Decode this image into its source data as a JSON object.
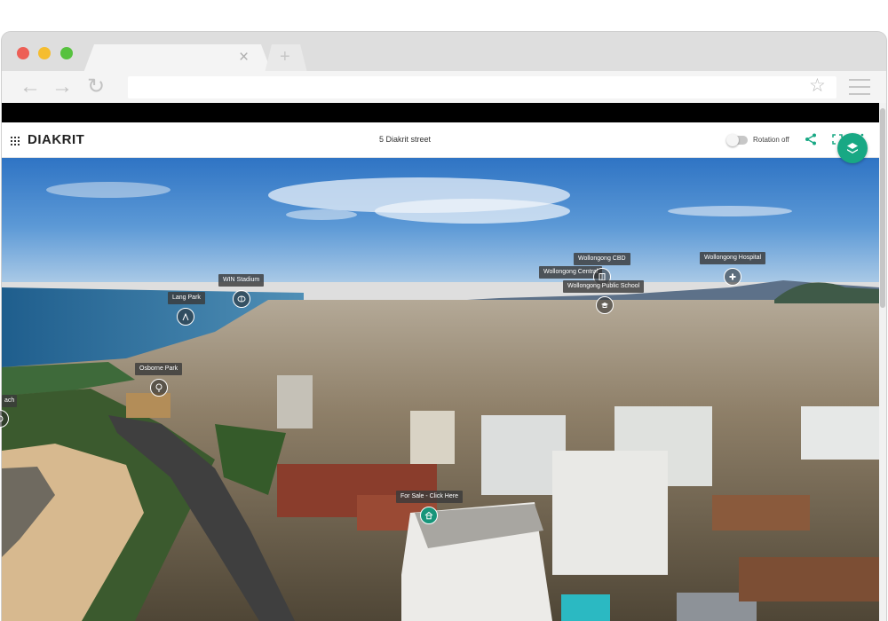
{
  "app": {
    "brand": "DIAKRIT",
    "address": "5 Diakrit street",
    "rotation_label": "Rotation off",
    "rotation_on": false
  },
  "browser": {
    "tab_close_glyph": "×",
    "new_tab_glyph": "+",
    "back_glyph": "←",
    "forward_glyph": "→",
    "reload_glyph": "↻",
    "star_glyph": "☆",
    "url": ""
  },
  "icons": {
    "apps": "grid-icon",
    "share": "share-icon",
    "fullscreen": "fullscreen-icon",
    "more": "more-vertical-icon",
    "layers": "layers-icon"
  },
  "colors": {
    "accent": "#18a884",
    "sale_pin": "#17957a",
    "label_bg": "#3a3a3a"
  },
  "pois": [
    {
      "id": "win-stadium",
      "label": "WIN Stadium",
      "icon": "stadium-icon"
    },
    {
      "id": "lang-park",
      "label": "Lang Park",
      "icon": "park-icon"
    },
    {
      "id": "osborne-park",
      "label": "Osborne Park",
      "icon": "tree-icon"
    },
    {
      "id": "wollongong-cbd",
      "label": "Wollongong CBD",
      "icon": "building-icon"
    },
    {
      "id": "wollongong-central",
      "label": "Wollongong Central",
      "icon": "shop-icon"
    },
    {
      "id": "wollongong-public-school",
      "label": "Wollongong Public School",
      "icon": "school-icon"
    },
    {
      "id": "wollongong-hospital",
      "label": "Wollongong Hospital",
      "icon": "hospital-icon"
    },
    {
      "id": "for-sale",
      "label": "For Sale - Click Here",
      "icon": "home-icon"
    },
    {
      "id": "edge-beach",
      "label": "ach",
      "icon": "beach-icon"
    }
  ]
}
